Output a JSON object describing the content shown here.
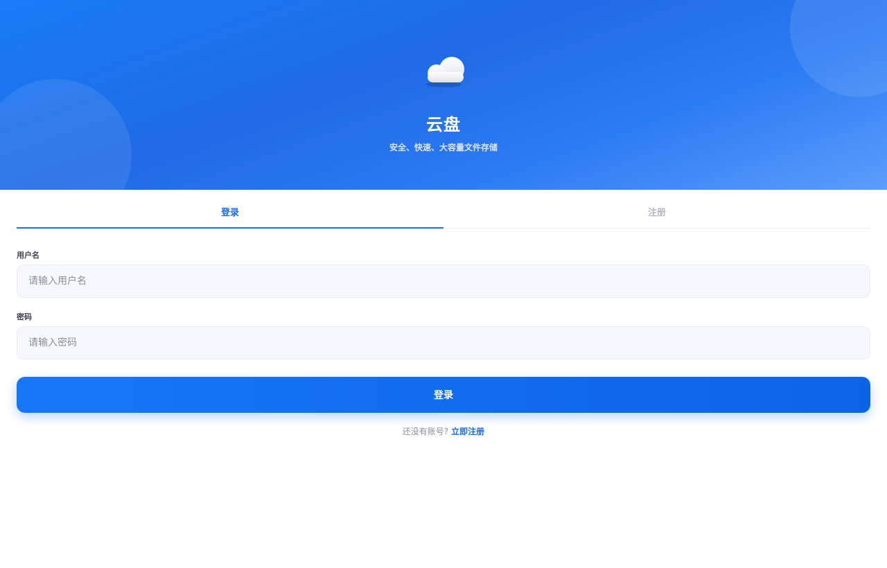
{
  "hero": {
    "icon": "cloud-icon",
    "title": "云盘",
    "subtitle": "安全、快速、大容量文件存储"
  },
  "tabs": [
    {
      "label": "登录",
      "active": true
    },
    {
      "label": "注册",
      "active": false
    }
  ],
  "form": {
    "username_label": "用户名",
    "username_placeholder": "请输入用户名",
    "username_value": "",
    "password_label": "密码",
    "password_placeholder": "请输入密码",
    "password_value": "",
    "submit_label": "登录"
  },
  "footer": {
    "prompt": "还没有账号?",
    "register_link": "立即注册"
  },
  "colors": {
    "accent": "#1a6cf0",
    "hero_gradient_start": "#1a7cf7",
    "hero_gradient_end": "#5c9dfb"
  }
}
